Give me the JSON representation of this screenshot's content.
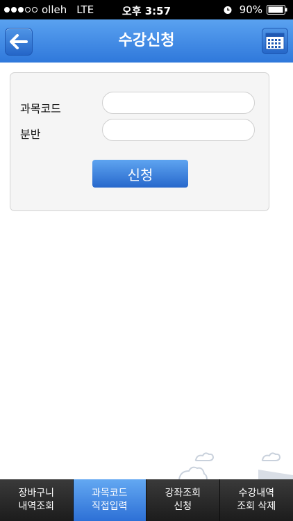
{
  "status_bar": {
    "carrier": "olleh",
    "network": "LTE",
    "time": "오후 3:57",
    "battery": "90%",
    "signal_bars": 3,
    "signal_max": 5
  },
  "header": {
    "title": "수강신청",
    "back_icon": "arrow-left-icon",
    "calendar_icon": "calendar-icon"
  },
  "form": {
    "course_code_label": "과목코드",
    "course_code_value": "",
    "section_label": "분반",
    "section_value": "",
    "submit_label": "신청"
  },
  "tabs": [
    {
      "line1": "장바구니",
      "line2": "내역조회",
      "active": false
    },
    {
      "line1": "과목코드",
      "line2": "직접입력",
      "active": true
    },
    {
      "line1": "강좌조회",
      "line2": "신청",
      "active": false
    },
    {
      "line1": "수강내역",
      "line2": "조회 삭제",
      "active": false
    }
  ],
  "colors": {
    "accent": "#3a86e6",
    "tab_bar": "#2a2a2a"
  }
}
